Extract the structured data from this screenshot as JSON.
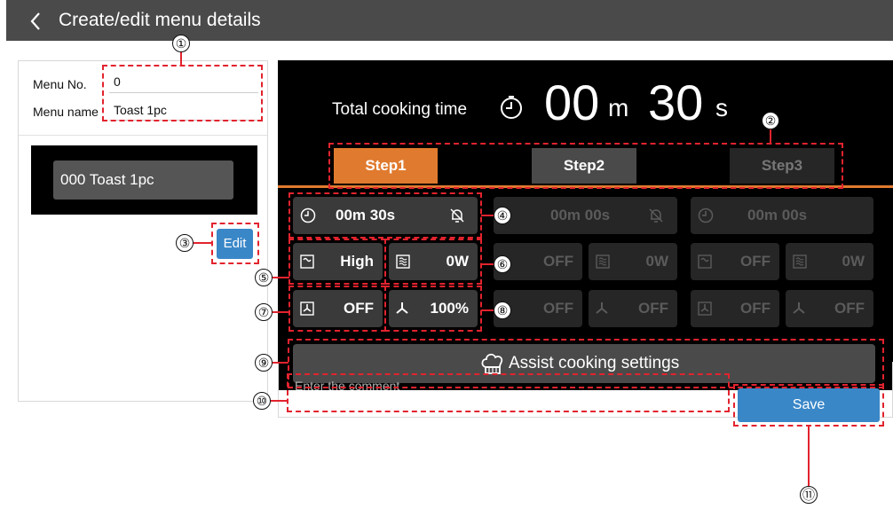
{
  "header": {
    "title": "Create/edit menu details",
    "back_icon": "chevron-left-icon"
  },
  "left": {
    "menu_no_label": "Menu No.",
    "menu_no_value": "0",
    "menu_name_label": "Menu name",
    "menu_name_value": "Toast 1pc",
    "preview_label": "000 Toast 1pc",
    "edit_label": "Edit"
  },
  "main": {
    "total_label": "Total cooking time",
    "total_min": "00",
    "total_min_unit": "m",
    "total_sec": "30",
    "total_sec_unit": "s",
    "steps": [
      "Step1",
      "Step2",
      "Step3"
    ],
    "step1": {
      "time": "00m 30s",
      "heat": "High",
      "micro": "0W",
      "fan": "OFF",
      "fan_speed": "100%"
    },
    "step2": {
      "time": "00m 00s",
      "heat": "OFF",
      "micro": "0W",
      "fan": "OFF",
      "fan_speed": "OFF"
    },
    "step3": {
      "time": "00m 00s",
      "heat": "OFF",
      "micro": "0W",
      "fan": "OFF",
      "fan_speed": "OFF"
    },
    "assist_label": "Assist cooking settings",
    "comment_placeholder": "Enter the comment",
    "save_label": "Save"
  },
  "callouts": [
    "①",
    "②",
    "③",
    "④",
    "⑤",
    "⑥",
    "⑦",
    "⑧",
    "⑨",
    "⑩",
    "⑪"
  ],
  "colors": {
    "accent_orange": "#e07a2e",
    "save_blue": "#3a87c8",
    "annotation_red": "#e2232e"
  }
}
